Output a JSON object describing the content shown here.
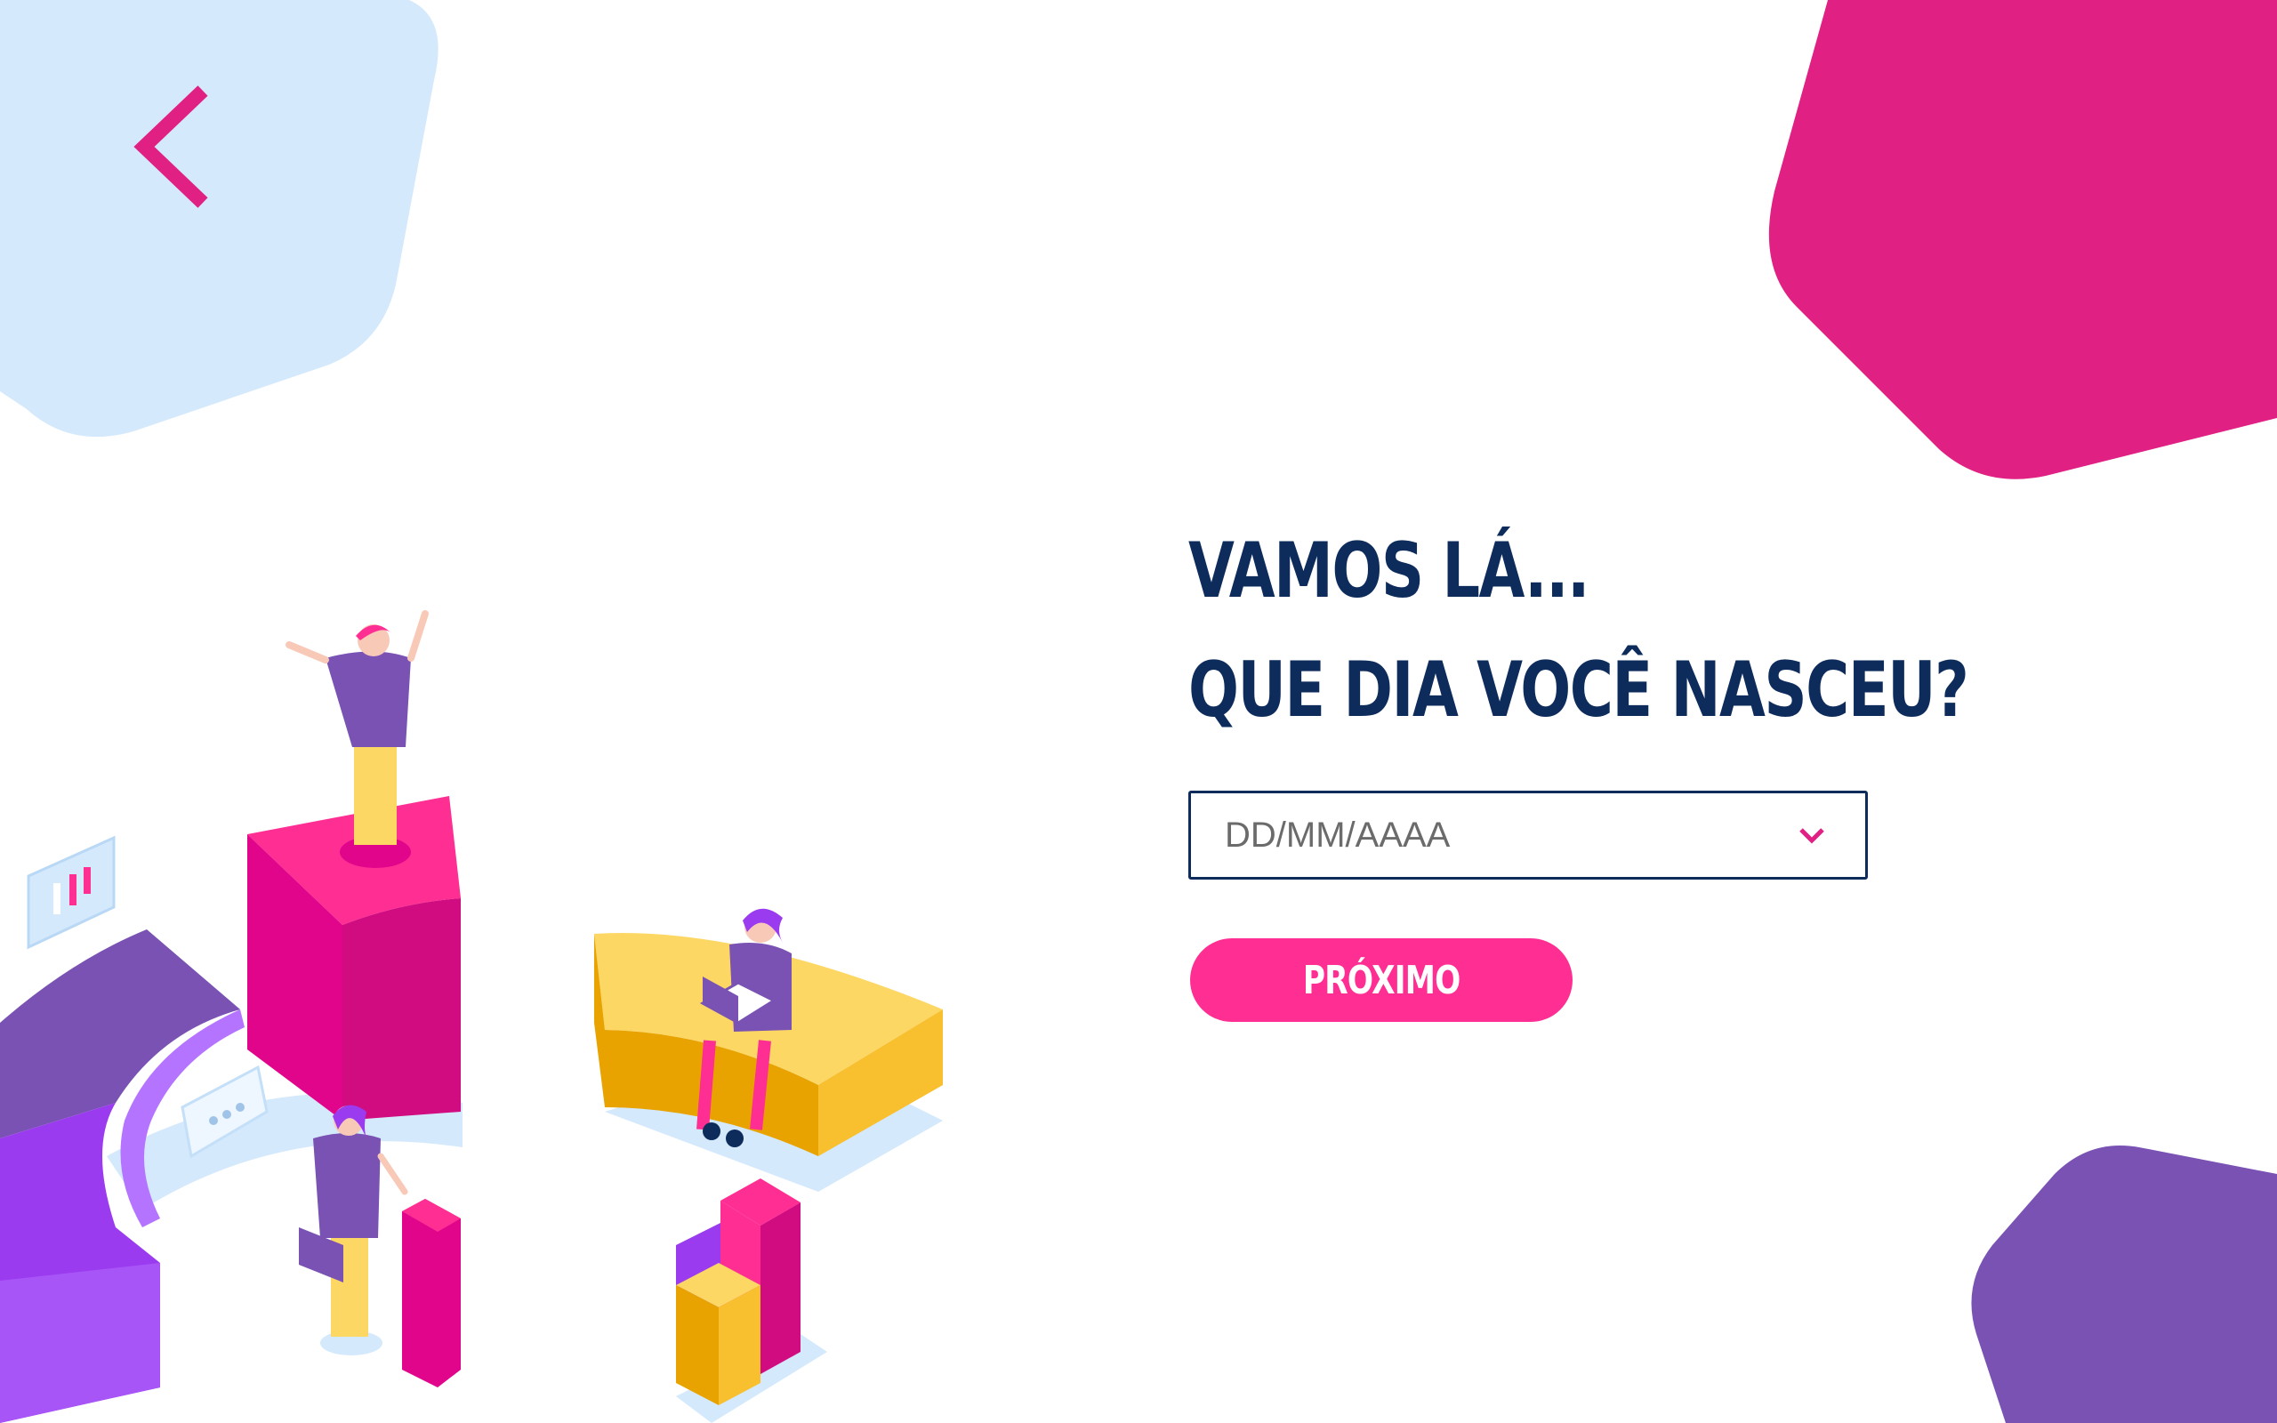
{
  "navigation": {
    "back_icon": "chevron-left-icon"
  },
  "question": {
    "line1": "VAMOS LÁ...",
    "line2": "QUE DIA VOCÊ NASCEU?"
  },
  "birthdate_field": {
    "placeholder": "DD/MM/AAAA",
    "value": "",
    "dropdown_icon": "chevron-down-icon"
  },
  "next_button": {
    "label": "PRÓXIMO"
  },
  "colors": {
    "brand_pink": "#ff2e93",
    "magenta_shape": "#e02082",
    "purple_shape": "#7952b3",
    "light_blue_shape": "#d4e9fc",
    "navy_text": "#0d2c5c"
  }
}
